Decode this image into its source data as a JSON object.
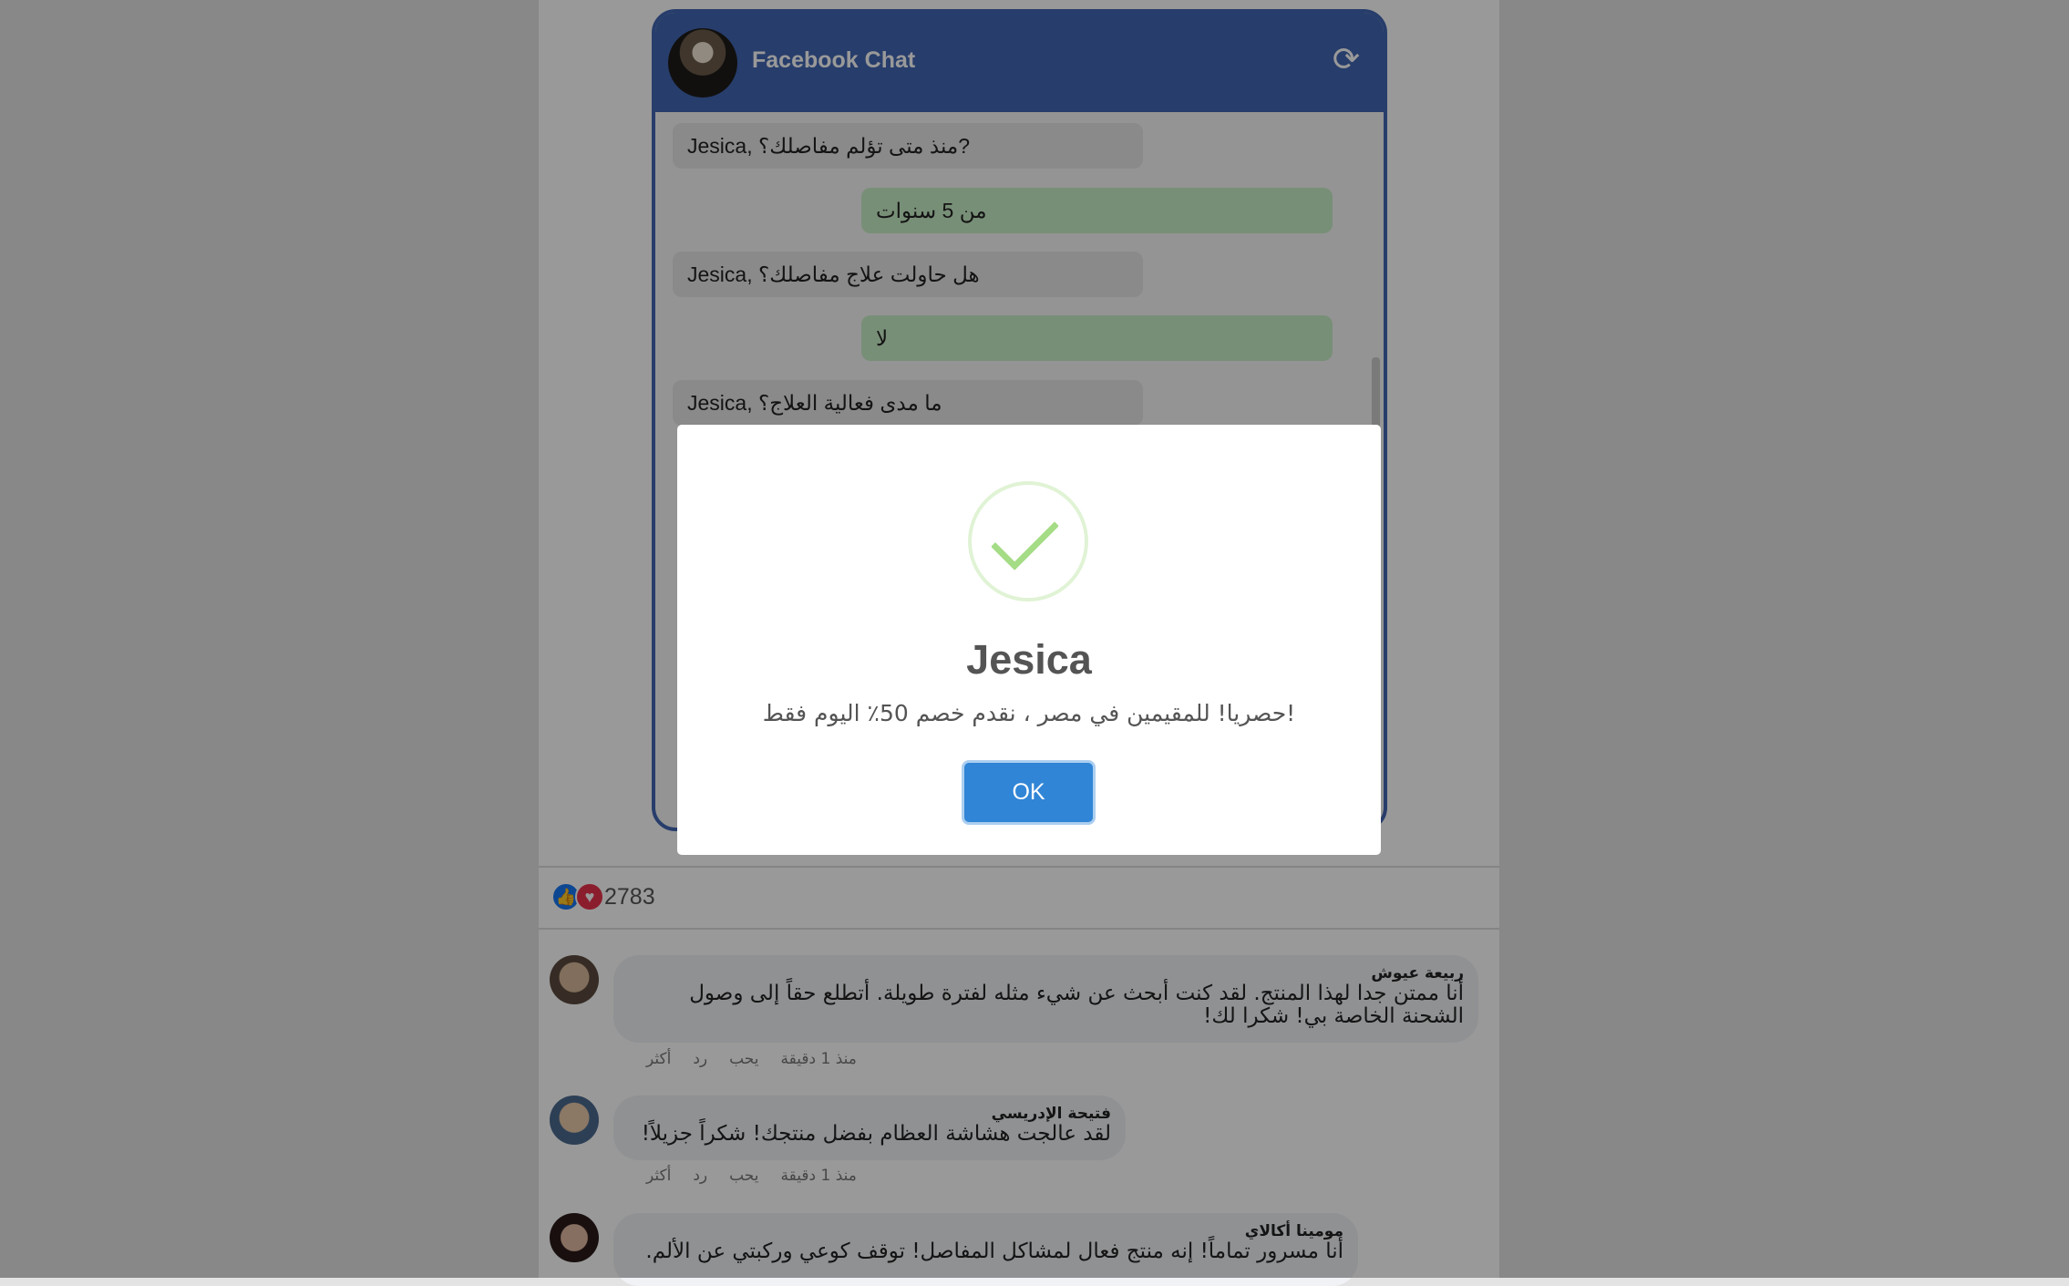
{
  "chat": {
    "title": "Facebook Chat",
    "messages": [
      {
        "from": "bot",
        "text": "Jesica, منذ متى تؤلم مفاصلك؟?"
      },
      {
        "from": "user",
        "text": "من 5 سنوات"
      },
      {
        "from": "bot",
        "text": "Jesica, هل حاولت علاج مفاصلك؟"
      },
      {
        "from": "user",
        "text": "لا"
      },
      {
        "from": "bot",
        "text": "Jesica, ما مدى فعالية العلاج؟"
      }
    ]
  },
  "reactions": {
    "count": "2783"
  },
  "comments": [
    {
      "name": "ربيعة عيوش",
      "text": "أنا ممتن جدا لهذا المنتج. لقد كنت أبحث عن شيء مثله لفترة طويلة. أتطلع حقاً إلى وصول الشحنة الخاصة بي! شكرا لك!",
      "time": "منذ 1 دقيقة",
      "like": "يحب",
      "reply": "رد",
      "more": "أكثر"
    },
    {
      "name": "فتيحة الإدريسي",
      "text": "لقد عالجت هشاشة العظام بفضل منتجك! شكراً جزيلاً!",
      "time": "منذ 1 دقيقة",
      "like": "يحب",
      "reply": "رد",
      "more": "أكثر"
    },
    {
      "name": "مومينا أكالاي",
      "text": "أنا مسرور تماماً! إنه منتج فعال لمشاكل المفاصل! توقف كوعي وركبتي عن الألم."
    }
  ],
  "modal": {
    "title": "Jesica",
    "text": "حصريا! للمقيمين في مصر ، نقدم خصم 50٪ اليوم فقط!",
    "ok": "OK"
  },
  "colors": {
    "brand": "#4267b2",
    "ok": "#3085d6",
    "success": "#a5dc86"
  }
}
